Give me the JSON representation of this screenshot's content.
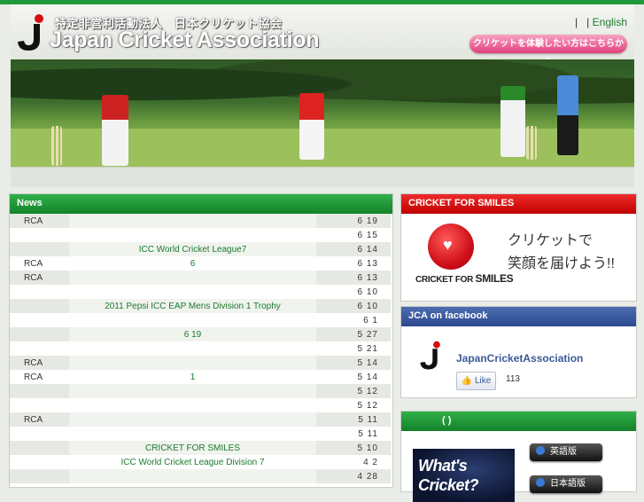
{
  "header": {
    "org_jp": "特定非営利活動法人　日本クリケット協会",
    "org_en": "Japan Cricket Association",
    "lang_sep": "|",
    "lang_english": "English",
    "try_button": "クリケットを体験したい方はこちらから"
  },
  "news": {
    "title": "News",
    "rows": [
      {
        "src": "RCA",
        "title": "",
        "date": "6 19"
      },
      {
        "src": "",
        "title": "",
        "date": "6 15"
      },
      {
        "src": "",
        "title": "ICC World Cricket League7",
        "date": "6 14"
      },
      {
        "src": "RCA",
        "title": "6",
        "date": "6 13"
      },
      {
        "src": "RCA",
        "title": "",
        "date": "6 13"
      },
      {
        "src": "",
        "title": "",
        "date": "6 10"
      },
      {
        "src": "",
        "title": "2011 Pepsi ICC EAP Mens Division 1 Trophy",
        "date": "6 10"
      },
      {
        "src": "",
        "title": "",
        "date": "6 1"
      },
      {
        "src": "",
        "title": "6 19",
        "date": "5 27"
      },
      {
        "src": "",
        "title": "",
        "date": "5 21"
      },
      {
        "src": "RCA",
        "title": "",
        "date": "5 14"
      },
      {
        "src": "RCA",
        "title": "1",
        "date": "5 14"
      },
      {
        "src": "",
        "title": "",
        "date": "5 12"
      },
      {
        "src": "",
        "title": "",
        "date": "5 12"
      },
      {
        "src": "RCA",
        "title": "",
        "date": "5 11"
      },
      {
        "src": "",
        "title": "",
        "date": "5 11"
      },
      {
        "src": "",
        "title": "CRICKET FOR SMILES",
        "date": "5 10"
      },
      {
        "src": "",
        "title": "ICC World Cricket League Division 7",
        "date": "4 2"
      },
      {
        "src": "",
        "title": "",
        "date": "4 28"
      }
    ]
  },
  "cfs": {
    "title": "CRICKET FOR SMILES",
    "brand_small": "CRICKET FOR",
    "brand_big": "SMILES",
    "line1": "クリケットで",
    "line2": "笑顔を届けよう!!"
  },
  "facebook": {
    "title": "JCA on facebook",
    "page_name": "JapanCricketAssociation",
    "like_label": "Like",
    "like_count": "113"
  },
  "video": {
    "title": "(   )",
    "thumb_line1": "What's",
    "thumb_line2": "Cricket?",
    "btn_en": "英語版",
    "btn_jp": "日本語版"
  },
  "colors": {
    "green": "#1f9a3a",
    "red": "#d50f0f",
    "blue": "#3b5998",
    "pink": "#e23f7b"
  }
}
